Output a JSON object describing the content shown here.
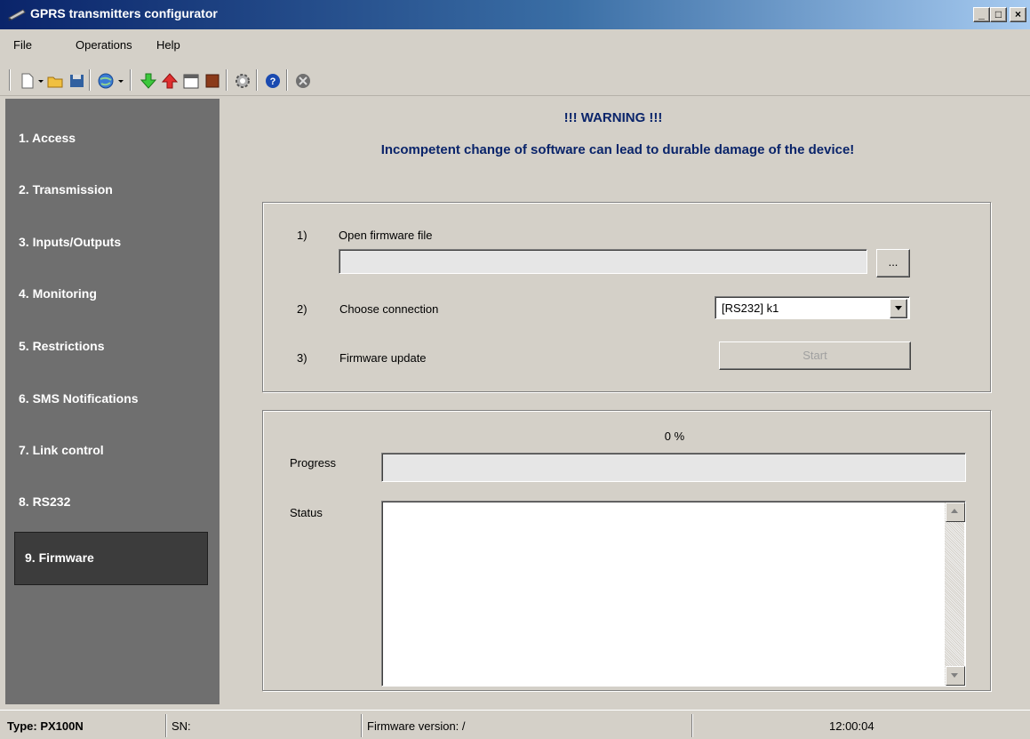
{
  "window": {
    "title": "GPRS transmitters configurator",
    "controls": [
      "_",
      "□",
      "×"
    ]
  },
  "menu": [
    "File",
    "Operations",
    "Help"
  ],
  "toolbar_icons": [
    "new-icon",
    "dropdown-arrow-icon",
    "open-folder-icon",
    "save-icon",
    "globe-icon",
    "dropdown-arrow-icon",
    "download-arrow-icon",
    "upload-arrow-icon",
    "calendar-icon",
    "book-icon",
    "gear-icon",
    "help-icon",
    "close-circle-icon"
  ],
  "sidebar": {
    "items": [
      {
        "label": "1. Access"
      },
      {
        "label": "2. Transmission"
      },
      {
        "label": "3. Inputs/Outputs"
      },
      {
        "label": "4. Monitoring"
      },
      {
        "label": "5. Restrictions"
      },
      {
        "label": "6. SMS Notifications"
      },
      {
        "label": "7. Link control"
      },
      {
        "label": "8. RS232"
      },
      {
        "label": "9. Firmware"
      }
    ],
    "active_index": 8
  },
  "warning": {
    "title": "!!! WARNING !!!",
    "message": "Incompetent change of software can lead to durable damage of the device!"
  },
  "steps": {
    "step1_num": "1)",
    "step1_label": "Open firmware file",
    "firmware_path": "",
    "browse_label": "...",
    "step2_num": "2)",
    "step2_label": "Choose connection",
    "connection_value": "[RS232] k1",
    "step3_num": "3)",
    "step3_label": "Firmware update",
    "start_label": "Start"
  },
  "progress": {
    "percent_text": "0 %",
    "value": 0,
    "label": "Progress",
    "status_label": "Status",
    "status_text": ""
  },
  "statusbar": {
    "type": "Type: PX100N",
    "sn": "SN:",
    "firmware_version": "Firmware version: /",
    "time": "12:00:04"
  }
}
